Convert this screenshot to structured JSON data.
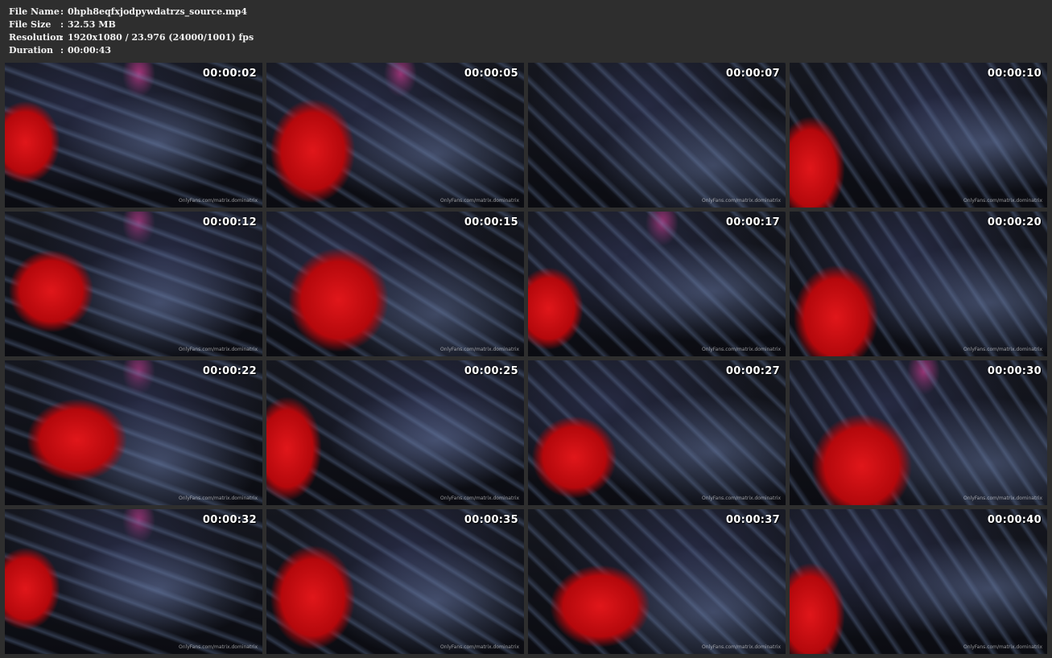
{
  "file_info": [
    {
      "label": "File Name",
      "value": "0hph8eqfxjodpywdatrzs_source.mp4"
    },
    {
      "label": "File Size",
      "value": "32.53 MB"
    },
    {
      "label": "Resolution",
      "value": "1920x1080 / 23.976 (24000/1001) fps"
    },
    {
      "label": "Duration",
      "value": "00:00:43"
    }
  ],
  "separator": ":",
  "watermark": "OnlyFans.com/matrix.dominatrix",
  "colors": {
    "background": "#2e2e2e",
    "latex_black": "#0b0c12",
    "highlight_blue": "#6f86b0",
    "glove_red": "#e0161a",
    "accent_pink": "#ff3aa0"
  },
  "thumbnails": [
    {
      "timestamp": "00:00:02",
      "red_glove": true
    },
    {
      "timestamp": "00:00:05",
      "red_glove": true
    },
    {
      "timestamp": "00:00:07",
      "red_glove": false
    },
    {
      "timestamp": "00:00:10",
      "red_glove": true
    },
    {
      "timestamp": "00:00:12",
      "red_glove": true
    },
    {
      "timestamp": "00:00:15",
      "red_glove": true
    },
    {
      "timestamp": "00:00:17",
      "red_glove": true
    },
    {
      "timestamp": "00:00:20",
      "red_glove": true
    },
    {
      "timestamp": "00:00:22",
      "red_glove": true
    },
    {
      "timestamp": "00:00:25",
      "red_glove": true
    },
    {
      "timestamp": "00:00:27",
      "red_glove": true
    },
    {
      "timestamp": "00:00:30",
      "red_glove": true
    },
    {
      "timestamp": "00:00:32",
      "red_glove": true
    },
    {
      "timestamp": "00:00:35",
      "red_glove": true
    },
    {
      "timestamp": "00:00:37",
      "red_glove": true
    },
    {
      "timestamp": "00:00:40",
      "red_glove": true
    }
  ]
}
